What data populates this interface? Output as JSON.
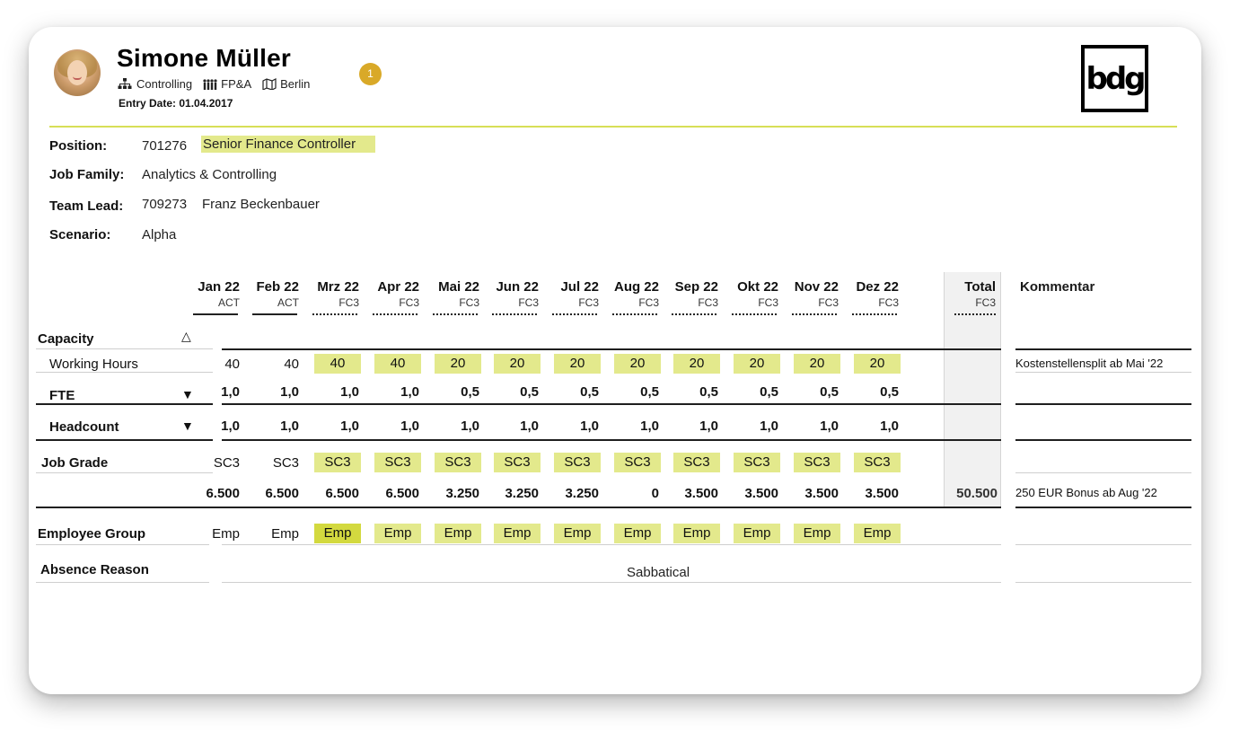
{
  "profile": {
    "name": "Simone Müller",
    "department": "Controlling",
    "team": "FP&A",
    "location": "Berlin",
    "entry_date": "Entry Date: 01.04.2017",
    "notification_count": "1",
    "logo_text": "bdg"
  },
  "details": {
    "position_label": "Position:",
    "position_id": "701276",
    "position_title": "Senior Finance Controller",
    "job_family_label": "Job Family:",
    "job_family": "Analytics & Controlling",
    "team_lead_label": "Team Lead:",
    "team_lead_id": "709273",
    "team_lead_name": "Franz Beckenbauer",
    "scenario_label": "Scenario:",
    "scenario": "Alpha"
  },
  "table": {
    "months": [
      "Jan 22",
      "Feb 22",
      "Mrz 22",
      "Apr 22",
      "Mai 22",
      "Jun 22",
      "Jul 22",
      "Aug 22",
      "Sep 22",
      "Okt 22",
      "Nov 22",
      "Dez 22"
    ],
    "month_types": [
      "ACT",
      "ACT",
      "FC3",
      "FC3",
      "FC3",
      "FC3",
      "FC3",
      "FC3",
      "FC3",
      "FC3",
      "FC3",
      "FC3"
    ],
    "total_label": "Total",
    "total_type": "FC3",
    "comment_header": "Kommentar",
    "rows": {
      "capacity_label": "Capacity",
      "working_hours_label": "Working Hours",
      "working_hours": [
        "40",
        "40",
        "40",
        "40",
        "20",
        "20",
        "20",
        "20",
        "20",
        "20",
        "20",
        "20"
      ],
      "working_hours_comment": "Kostenstellensplit ab Mai '22",
      "fte_label": "FTE",
      "fte": [
        "1,0",
        "1,0",
        "1,0",
        "1,0",
        "0,5",
        "0,5",
        "0,5",
        "0,5",
        "0,5",
        "0,5",
        "0,5",
        "0,5"
      ],
      "headcount_label": "Headcount",
      "headcount": [
        "1,0",
        "1,0",
        "1,0",
        "1,0",
        "1,0",
        "1,0",
        "1,0",
        "1,0",
        "1,0",
        "1,0",
        "1,0",
        "1,0"
      ],
      "job_grade_label": "Job Grade",
      "job_grade": [
        "SC3",
        "SC3",
        "SC3",
        "SC3",
        "SC3",
        "SC3",
        "SC3",
        "SC3",
        "SC3",
        "SC3",
        "SC3",
        "SC3"
      ],
      "amounts": [
        "6.500",
        "6.500",
        "6.500",
        "6.500",
        "3.250",
        "3.250",
        "3.250",
        "0",
        "3.500",
        "3.500",
        "3.500",
        "3.500"
      ],
      "amounts_total": "50.500",
      "amounts_comment": "250 EUR Bonus ab Aug  '22",
      "employee_group_label": "Employee Group",
      "employee_group": [
        "Emp",
        "Emp",
        "Emp",
        "Emp",
        "Emp",
        "Emp",
        "Emp",
        "Emp",
        "Emp",
        "Emp",
        "Emp",
        "Emp"
      ],
      "absence_reason_label": "Absence Reason",
      "absence_reason": "Sabbatical"
    }
  },
  "colors": {
    "highlight": "#e3e98c",
    "highlight_strong": "#d3d93f",
    "accent_line": "#d7df57",
    "badge": "#d9a928"
  }
}
